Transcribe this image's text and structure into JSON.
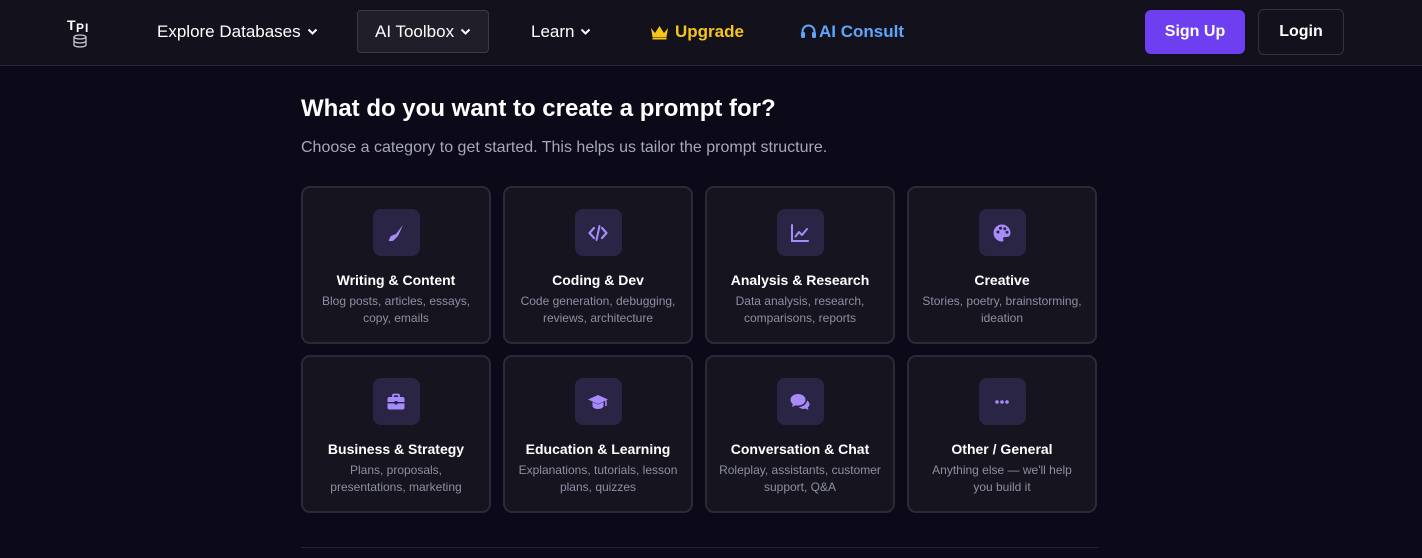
{
  "nav": {
    "logo_text": "TPI",
    "items": [
      {
        "label": "Explore Databases"
      },
      {
        "label": "AI Toolbox"
      },
      {
        "label": "Learn"
      }
    ],
    "upgrade_label": "Upgrade",
    "consult_label": "AI Consult",
    "signup_label": "Sign Up",
    "login_label": "Login"
  },
  "main": {
    "title": "What do you want to create a prompt for?",
    "subtitle": "Choose a category to get started. This helps us tailor the prompt structure.",
    "categories": [
      {
        "icon": "paintbrush-icon",
        "title": "Writing & Content",
        "desc": "Blog posts, articles, essays, copy, emails"
      },
      {
        "icon": "code-icon",
        "title": "Coding & Dev",
        "desc": "Code generation, debugging, reviews, architecture"
      },
      {
        "icon": "chart-line-icon",
        "title": "Analysis & Research",
        "desc": "Data analysis, research, comparisons, reports"
      },
      {
        "icon": "palette-icon",
        "title": "Creative",
        "desc": "Stories, poetry, brainstorming, ideation"
      },
      {
        "icon": "briefcase-icon",
        "title": "Business & Strategy",
        "desc": "Plans, proposals, presentations, marketing"
      },
      {
        "icon": "graduation-cap-icon",
        "title": "Education & Learning",
        "desc": "Explanations, tutorials, lesson plans, quizzes"
      },
      {
        "icon": "chat-bubbles-icon",
        "title": "Conversation & Chat",
        "desc": "Roleplay, assistants, customer support, Q&A"
      },
      {
        "icon": "ellipsis-icon",
        "title": "Other / General",
        "desc": "Anything else — we'll help you build it"
      }
    ]
  },
  "colors": {
    "background": "#0c0a18",
    "nav_background": "#12111c",
    "accent_purple": "#6d3ff0",
    "icon_purple": "#a78bfa",
    "upgrade_gold": "#f5c518",
    "consult_blue": "#60a5fa"
  }
}
